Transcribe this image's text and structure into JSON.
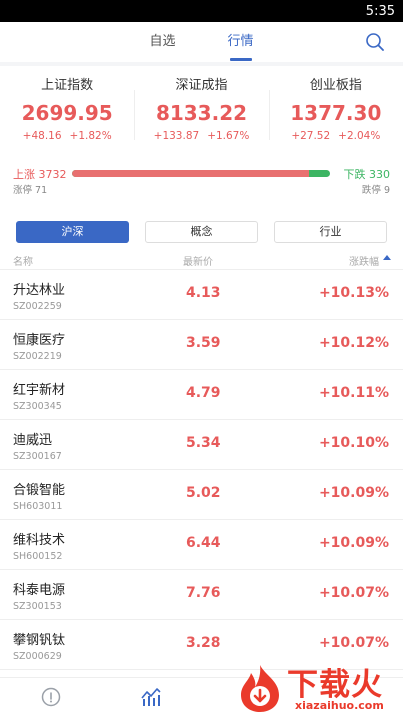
{
  "status": {
    "time": "5:35"
  },
  "topnav": {
    "tabs": [
      {
        "label": "自选"
      },
      {
        "label": "行情"
      }
    ],
    "active_tab": 1
  },
  "indices": [
    {
      "name": "上证指数",
      "value": "2699.95",
      "change": "+48.16",
      "pct": "+1.82%"
    },
    {
      "name": "深证成指",
      "value": "8133.22",
      "change": "+133.87",
      "pct": "+1.67%"
    },
    {
      "name": "创业板指",
      "value": "1377.30",
      "change": "+27.52",
      "pct": "+2.04%"
    }
  ],
  "breadth": {
    "up_label": "上涨 3732",
    "down_label": "下跌 330",
    "limit_up_label": "涨停 71",
    "limit_down_label": "跌停 9",
    "up_count": 3732,
    "down_count": 330
  },
  "segments": [
    {
      "label": "沪深"
    },
    {
      "label": "概念"
    },
    {
      "label": "行业"
    }
  ],
  "active_segment": 0,
  "columns": {
    "name": "名称",
    "price": "最新价",
    "change": "涨跌幅"
  },
  "stocks": [
    {
      "name": "升达林业",
      "code": "SZ002259",
      "price": "4.13",
      "change": "+10.13%"
    },
    {
      "name": "恒康医疗",
      "code": "SZ002219",
      "price": "3.59",
      "change": "+10.12%"
    },
    {
      "name": "红宇新材",
      "code": "SZ300345",
      "price": "4.79",
      "change": "+10.11%"
    },
    {
      "name": "迪威迅",
      "code": "SZ300167",
      "price": "5.34",
      "change": "+10.10%"
    },
    {
      "name": "合锻智能",
      "code": "SH603011",
      "price": "5.02",
      "change": "+10.09%"
    },
    {
      "name": "维科技术",
      "code": "SH600152",
      "price": "6.44",
      "change": "+10.09%"
    },
    {
      "name": "科泰电源",
      "code": "SZ300153",
      "price": "7.76",
      "change": "+10.07%"
    },
    {
      "name": "攀钢钒钛",
      "code": "SZ000629",
      "price": "3.28",
      "change": "+10.07%"
    }
  ],
  "watermark": {
    "text": "下载火",
    "url": "xiazaihuo.com"
  },
  "colors": {
    "accent": "#3a68c5",
    "up": "#e75a5a",
    "down": "#3cb563"
  },
  "icons": {
    "search": "search-icon",
    "home": "info-circle-icon",
    "market": "chart-bars-icon"
  }
}
